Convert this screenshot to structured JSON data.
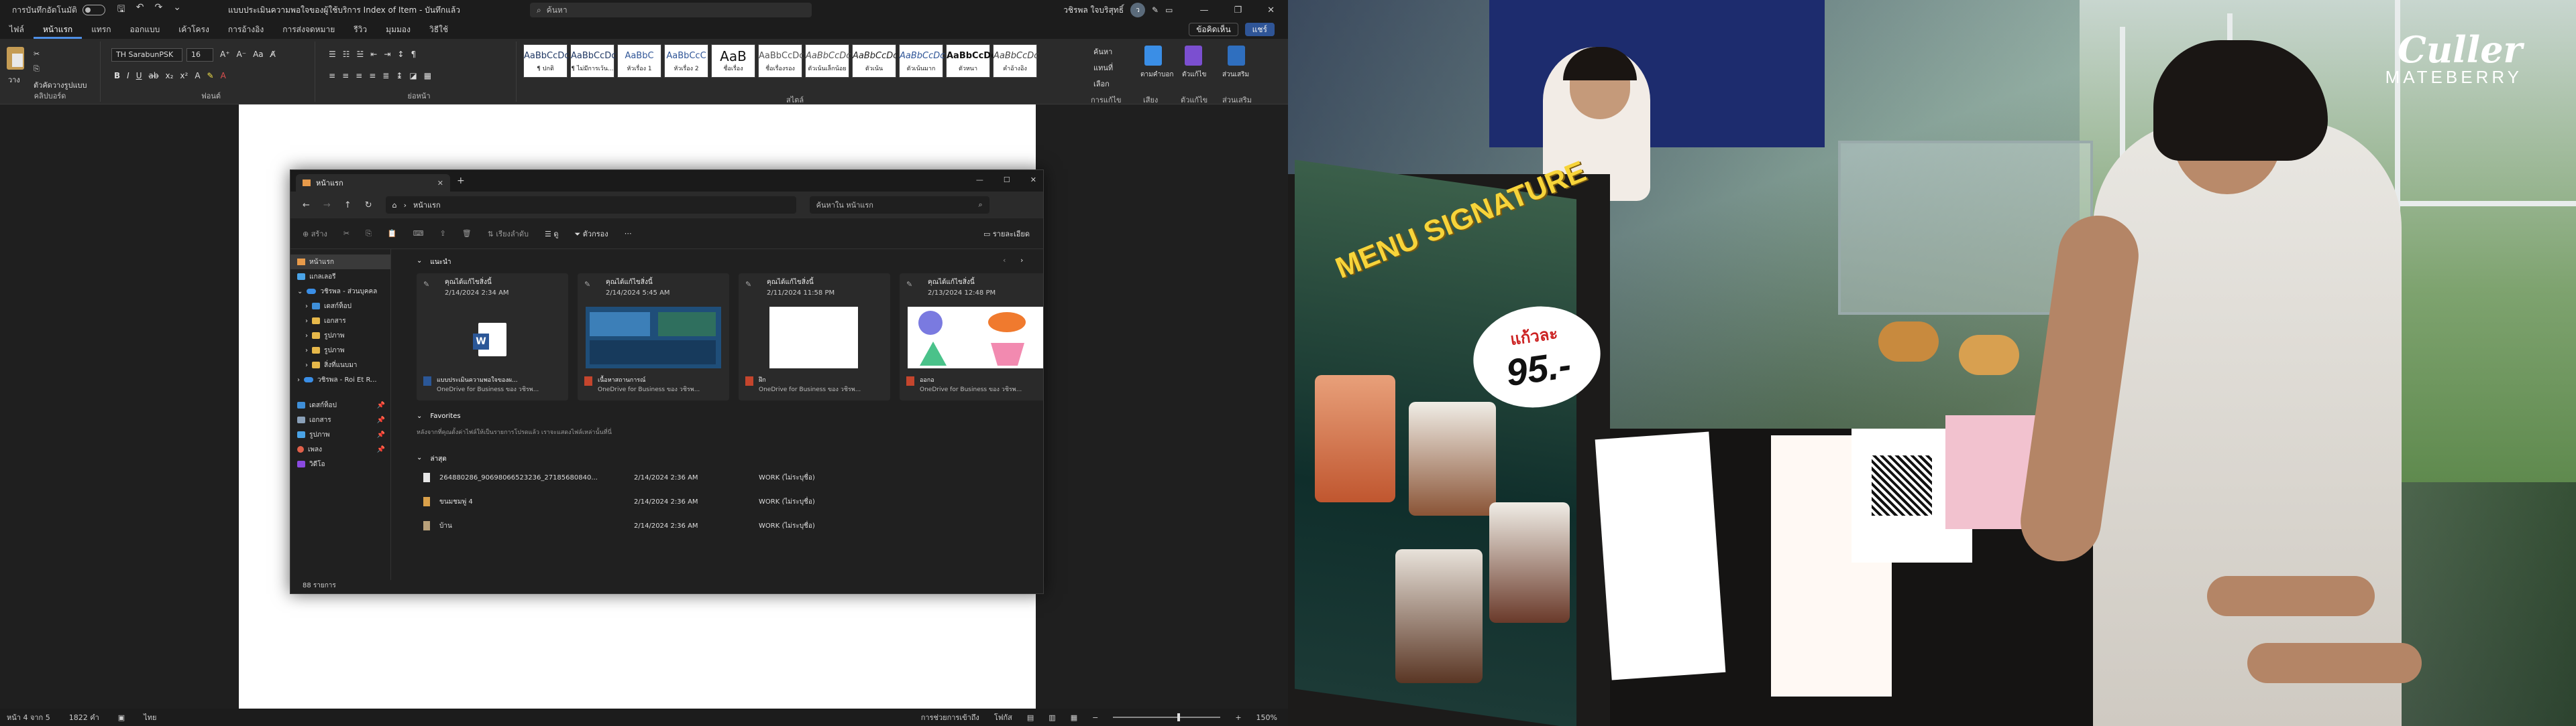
{
  "word": {
    "titlebar": {
      "autosave_label": "การบันทึกอัตโนมัติ",
      "doc_title": "แบบประเมินความพอใจของผู้ใช้บริการ Index of Item - บันทึกแล้ว",
      "search_placeholder": "ค้นหา",
      "user_name": "วชิรพล ใจบริสุทธิ์",
      "avatar_initials": "ว"
    },
    "tabs": [
      "ไฟล์",
      "หน้าแรก",
      "แทรก",
      "ออกแบบ",
      "เค้าโครง",
      "การอ้างอิง",
      "การส่งจดหมาย",
      "รีวิว",
      "มุมมอง",
      "วิธีใช้"
    ],
    "active_tab": "หน้าแรก",
    "comment_label": "ข้อคิดเห็น",
    "share_label": "แชร์",
    "ribbon": {
      "paste_label": "วาง",
      "font_name": "TH SarabunPSK",
      "font_size": "16",
      "format_painter": "ตัวคัดวางรูปแบบ",
      "groups": [
        "คลิปบอร์ด",
        "ฟอนต์",
        "ย่อหน้า",
        "สไตล์",
        "การแก้ไข",
        "เสียง",
        "ตัวแก้ไข",
        "ส่วนเสริม"
      ],
      "styles": [
        {
          "sample": "AaBbCcDc",
          "name": "¶ ปกติ"
        },
        {
          "sample": "AaBbCcDc",
          "name": "¶ ไม่มีการเว้น..."
        },
        {
          "sample": "AaBbC",
          "name": "หัวเรื่อง 1"
        },
        {
          "sample": "AaBbCcC",
          "name": "หัวเรื่อง 2"
        },
        {
          "sample": "AaB",
          "name": "ชื่อเรื่อง"
        },
        {
          "sample": "AaBbCcDc",
          "name": "ชื่อเรื่องรอง"
        },
        {
          "sample": "AaBbCcDc",
          "name": "ตัวเน้นเล็กน้อย"
        },
        {
          "sample": "AaBbCcDc",
          "name": "ตัวเน้น"
        },
        {
          "sample": "AaBbCcDc",
          "name": "ตัวเน้นมาก"
        },
        {
          "sample": "AaBbCcDc",
          "name": "ตัวหนา"
        },
        {
          "sample": "AaBbCcDc",
          "name": "คำอ้างอิง"
        }
      ],
      "find_label": "ค้นหา",
      "replace_label": "แทนที่",
      "select_label": "เลือก",
      "dictate_label": "ตามคำบอก",
      "editor_label": "ตัวแก้ไข",
      "addins_label": "ส่วนเสริม"
    },
    "status": {
      "page": "หน้า 4 จาก 5",
      "words": "1822 คำ",
      "lang": "ไทย",
      "focus": "โฟกัส",
      "accessibility": "การช่วยการเข้าถึง",
      "zoom": "150%"
    }
  },
  "explorer": {
    "tab_title": "หน้าแรก",
    "address": "หน้าแรก",
    "search_placeholder": "ค้นหาใน หน้าแรก",
    "cmd": {
      "new": "สร้าง",
      "sort": "เรียงลำดับ",
      "view": "ดู",
      "filter": "ตัวกรอง",
      "details": "รายละเอียด"
    },
    "sidebar": [
      {
        "label": "หน้าแรก",
        "icon": "home-icon"
      },
      {
        "label": "แกลเลอรี",
        "icon": "gallery-icon"
      },
      {
        "label": "วชิรพล - ส่วนบุคคล",
        "icon": "onedrive-icon"
      },
      {
        "label": "เดสก์ท็อป",
        "icon": "folder-icon"
      },
      {
        "label": "เอกสาร",
        "icon": "folder-icon"
      },
      {
        "label": "รูปภาพ",
        "icon": "folder-icon"
      },
      {
        "label": "รูปภาพ",
        "icon": "folder-icon"
      },
      {
        "label": "สิ่งที่แนบมา",
        "icon": "folder-icon"
      },
      {
        "label": "วชิรพล - Roi Et R...",
        "icon": "onedrive-icon"
      },
      {
        "label": "เดสก์ท็อป",
        "icon": "folder-icon"
      },
      {
        "label": "เอกสาร",
        "icon": "folder-icon"
      },
      {
        "label": "รูปภาพ",
        "icon": "folder-icon"
      },
      {
        "label": "เพลง",
        "icon": "music-icon"
      },
      {
        "label": "วิดีโอ",
        "icon": "video-icon"
      }
    ],
    "quick_access_title": "แนะนำ",
    "cards": [
      {
        "title": "คุณได้แก้ไขสิ่งนี้",
        "date": "2/14/2024 2:34 AM",
        "file": "แบบประเมินความพอใจของผ...",
        "location": "OneDrive for Business ของ วชิรพ..."
      },
      {
        "title": "คุณได้แก้ไขสิ่งนี้",
        "date": "2/14/2024 5:45 AM",
        "file": "เนื้อหาสถานการณ์",
        "location": "OneDrive for Business ของ วชิรพ..."
      },
      {
        "title": "คุณได้แก้ไขสิ่งนี้",
        "date": "2/11/2024 11:58 PM",
        "file": "ฝึก",
        "location": "OneDrive for Business ของ วชิรพ..."
      },
      {
        "title": "คุณได้แก้ไขสิ่งนี้",
        "date": "2/13/2024 12:48 PM",
        "file": "ออกอ",
        "location": "OneDrive for Business ของ วชิรพ..."
      }
    ],
    "favorites_title": "Favorites",
    "favorites_hint": "หลังจากที่คุณตั้งค่าไฟล์ให้เป็นรายการโปรดแล้ว เราจะแสดงไฟล์เหล่านั้นที่นี่",
    "recent_title": "ล่าสุด",
    "recent": [
      {
        "name": "264880286_9069806652323​6_2718568084​0...",
        "date": "2/14/2024 2:36 AM",
        "location": "WORK (ไม่ระบุชื่อ)"
      },
      {
        "name": "ขนมชมพู่ 4",
        "date": "2/14/2024 2:36 AM",
        "location": "WORK (ไม่ระบุชื่อ)"
      },
      {
        "name": "บ้าน",
        "date": "2/14/2024 2:36 AM",
        "location": "WORK (ไม่ระบุชื่อ)"
      }
    ],
    "item_count": "88 รายการ"
  },
  "video": {
    "brand_line1": "Culler",
    "brand_line2": "MATEBERRY",
    "menu_text": "MENU SIGNATURE",
    "price_label": "แก้วละ",
    "price_value": "95.-"
  }
}
